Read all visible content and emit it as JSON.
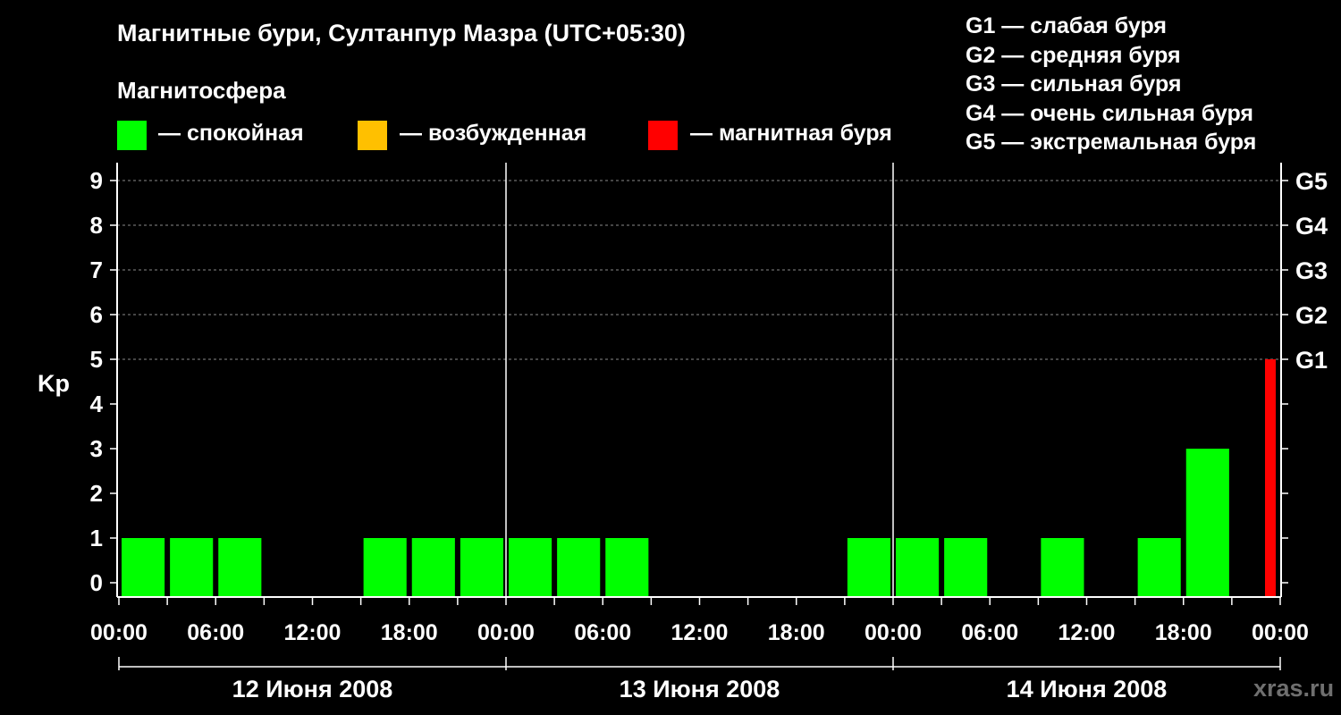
{
  "chart_data": {
    "type": "bar",
    "title": "Магнитные бури, Султанпур Мазра (UTC+05:30)",
    "subtitle": "Магнитосфера",
    "ylabel": "Kp",
    "ylim": [
      0,
      9
    ],
    "yticks": [
      "0",
      "1",
      "2",
      "3",
      "4",
      "5",
      "6",
      "7",
      "8",
      "9"
    ],
    "g_levels": [
      {
        "label": "G1",
        "kp": 5
      },
      {
        "label": "G2",
        "kp": 6
      },
      {
        "label": "G3",
        "kp": 7
      },
      {
        "label": "G4",
        "kp": 8
      },
      {
        "label": "G5",
        "kp": 9
      }
    ],
    "x_range_hours": [
      0,
      72
    ],
    "xtick_labels": [
      "00:00",
      "06:00",
      "12:00",
      "18:00",
      "00:00",
      "06:00",
      "12:00",
      "18:00",
      "00:00",
      "06:00",
      "12:00",
      "18:00",
      "00:00"
    ],
    "days": [
      "12 Июня 2008",
      "13 Июня 2008",
      "14 Июня 2008"
    ],
    "bars": [
      {
        "start": 0,
        "kp": 1,
        "level": "quiet"
      },
      {
        "start": 3,
        "kp": 1,
        "level": "quiet"
      },
      {
        "start": 6,
        "kp": 1,
        "level": "quiet"
      },
      {
        "start": 9,
        "kp": 0,
        "level": "quiet"
      },
      {
        "start": 12,
        "kp": 0,
        "level": "quiet"
      },
      {
        "start": 15,
        "kp": 1,
        "level": "quiet"
      },
      {
        "start": 18,
        "kp": 1,
        "level": "quiet"
      },
      {
        "start": 21,
        "kp": 1,
        "level": "quiet"
      },
      {
        "start": 24,
        "kp": 1,
        "level": "quiet"
      },
      {
        "start": 27,
        "kp": 1,
        "level": "quiet"
      },
      {
        "start": 30,
        "kp": 1,
        "level": "quiet"
      },
      {
        "start": 33,
        "kp": 0,
        "level": "quiet"
      },
      {
        "start": 36,
        "kp": 0,
        "level": "quiet"
      },
      {
        "start": 39,
        "kp": 0,
        "level": "quiet"
      },
      {
        "start": 42,
        "kp": 0,
        "level": "quiet"
      },
      {
        "start": 45,
        "kp": 1,
        "level": "quiet"
      },
      {
        "start": 48,
        "kp": 1,
        "level": "quiet"
      },
      {
        "start": 51,
        "kp": 1,
        "level": "quiet"
      },
      {
        "start": 54,
        "kp": 0,
        "level": "quiet"
      },
      {
        "start": 57,
        "kp": 1,
        "level": "quiet"
      },
      {
        "start": 60,
        "kp": 0,
        "level": "quiet"
      },
      {
        "start": 63,
        "kp": 1,
        "level": "quiet"
      },
      {
        "start": 66,
        "kp": 3,
        "level": "quiet"
      },
      {
        "start": 69,
        "kp": 5,
        "level": "storm"
      }
    ],
    "grid": true,
    "legend_position": "top",
    "legend": [
      {
        "key": "quiet",
        "label": "— спокойная",
        "color": "#00ff00"
      },
      {
        "key": "excited",
        "label": "— возбужденная",
        "color": "#ffc000"
      },
      {
        "key": "storm",
        "label": "— магнитная буря",
        "color": "#ff0000"
      }
    ],
    "g_legend": [
      "G1 — слабая буря",
      "G2 — средняя буря",
      "G3 — сильная буря",
      "G4 — очень сильная буря",
      "G5 — экстремальная буря"
    ]
  },
  "watermark": "xras.ru"
}
